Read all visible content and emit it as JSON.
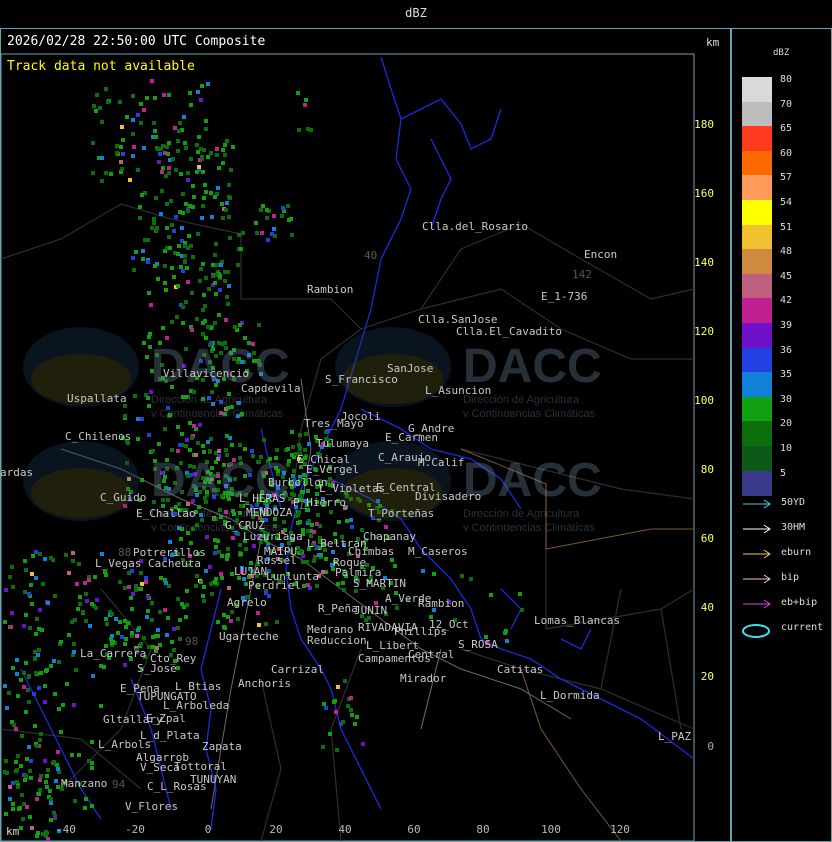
{
  "header": {
    "title": "dBZ"
  },
  "map": {
    "timestamp_title": "2026/02/28 22:50:00 UTC Composite",
    "notice": "Track data not available",
    "unit_top": "km",
    "unit_bottom": "km",
    "y_ticks": [
      "180",
      "160",
      "140",
      "120",
      "100",
      "80",
      "60",
      "40",
      "20",
      "0"
    ],
    "x_ticks": [
      "-40",
      "-20",
      "0",
      "20",
      "40",
      "60",
      "80",
      "100",
      "120"
    ],
    "watermark": {
      "brand": "DACC",
      "line1": "Dirección de Agricultura",
      "line2": "y Contingencias Climáticas"
    },
    "places": [
      "Clla.del_Rosario",
      "Encon",
      "142",
      "E_1-736",
      "Rambion",
      "Clla.SanJose",
      "Clla.El_Cavadito",
      "Villavicencio",
      "Uspallata",
      "C_Chilenos",
      "Capdevila",
      "S_Francisco",
      "SanJose",
      "L_Asuncion",
      "Tres_Mayo",
      "Jocoli",
      "E_Carmen",
      "G_Andre",
      "Tulumaya",
      "C_Araujo",
      "M.Calif",
      "E_Chical",
      "E_Vergel",
      "Burbollon",
      "L_Violetas",
      "E_Central",
      "Divisadero",
      "C_Guido",
      "E_Challao",
      "L_HERAS",
      "P_Hierro",
      "MENDOZA",
      "G_CRUZ",
      "T_Porteñas",
      "Luzuriaga",
      "L_Beltran",
      "Chapanay",
      "MAIPU",
      "Chimbas",
      "M_Caseros",
      "Potrerillos",
      "L_Vegas",
      "Cacheuta",
      "Russel",
      "Roque",
      "Palmira",
      "LUJAN",
      "Lunlunta",
      "S_MARTIN",
      "Perdriel",
      "A_Verde",
      "Agrelo",
      "R_Peña",
      "JUNIN",
      "Rambion",
      "Ugarteche",
      "Medrano",
      "RIVADAVIA",
      "12_Oct",
      "Reduccion",
      "L_Libert",
      "Phillips",
      "S_ROSA",
      "Lomas_Blancas",
      "La_Carrera",
      "Cto_Rey",
      "S_Jose",
      "Campamentos",
      "Central",
      "Carrizal",
      "Catitas",
      "E_Pena",
      "L_Btias",
      "Anchoris",
      "TUPUNGATO",
      "Mirador",
      "L_Dormida",
      "L_Arboleda",
      "Gltallary",
      "E_Zpal",
      "L_d_Plata",
      "Zapata",
      "L_Arbols",
      "Algarrob",
      "V_Seca",
      "Tottoral",
      "L_PAZ",
      "TUNUYAN",
      "Manzano",
      "C_L_Rosas",
      "V_Flores",
      "ardas",
      "88",
      "94",
      "98",
      "40"
    ]
  },
  "legend": {
    "title": "dBZ",
    "levels": [
      {
        "label": "80",
        "color": "#d9d9d9"
      },
      {
        "label": "70",
        "color": "#bdbdbd"
      },
      {
        "label": "65",
        "color": "#ff3a1f"
      },
      {
        "label": "60",
        "color": "#ff6a00"
      },
      {
        "label": "57",
        "color": "#ff9a5a"
      },
      {
        "label": "54",
        "color": "#ffff00"
      },
      {
        "label": "51",
        "color": "#f0c030"
      },
      {
        "label": "48",
        "color": "#d08a40"
      },
      {
        "label": "45",
        "color": "#c06080"
      },
      {
        "label": "42",
        "color": "#c02090"
      },
      {
        "label": "39",
        "color": "#7010c8"
      },
      {
        "label": "36",
        "color": "#2040e0"
      },
      {
        "label": "35",
        "color": "#1080d8"
      },
      {
        "label": "30",
        "color": "#10a010"
      },
      {
        "label": "20",
        "color": "#0a6e0a"
      },
      {
        "label": "10",
        "color": "#0c5a18"
      },
      {
        "label": "5",
        "color": "#3a3a8a"
      }
    ],
    "tracks": [
      {
        "label": "50YD",
        "color": "#40d0e0"
      },
      {
        "label": "30HM",
        "color": "#ffffff"
      },
      {
        "label": "eburn",
        "color": "#ffc060"
      },
      {
        "label": "bip",
        "color": "#ffc0c0"
      },
      {
        "label": "eb+bip",
        "color": "#e040e0"
      },
      {
        "label": "current",
        "color": "#40e0f0"
      }
    ]
  }
}
